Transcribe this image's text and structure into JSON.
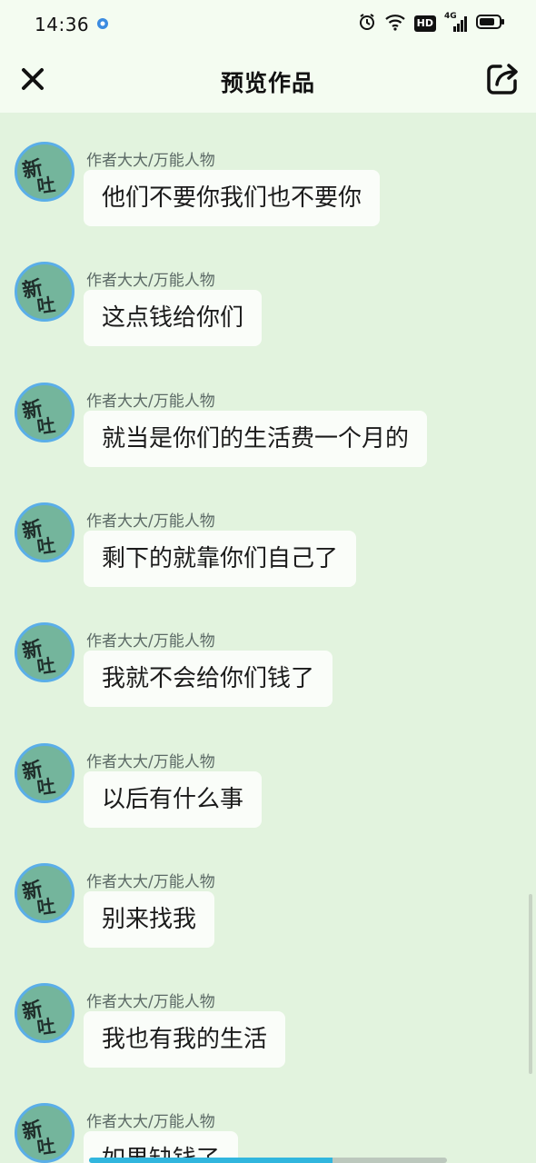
{
  "status_bar": {
    "time": "14:36",
    "network": "4G",
    "hd_badge": "HD",
    "icons": [
      "app-notification-icon",
      "alarm-icon",
      "wifi-icon",
      "hd-icon",
      "signal-icon",
      "battery-icon"
    ]
  },
  "header": {
    "title": "预览作品",
    "left_icon": "close-icon",
    "right_icon": "share-icon"
  },
  "colors": {
    "background": "#e2f3de",
    "header_background": "#f4fcf1",
    "bubble": "#fafdf9",
    "avatar_fill": "#74b59c",
    "avatar_border": "#5aaee8",
    "progress": "#31b6de"
  },
  "messages": [
    {
      "author": "作者大大/万能人物",
      "text": "他们不要你我们也不要你"
    },
    {
      "author": "作者大大/万能人物",
      "text": "这点钱给你们"
    },
    {
      "author": "作者大大/万能人物",
      "text": "就当是你们的生活费一个月的"
    },
    {
      "author": "作者大大/万能人物",
      "text": "剩下的就靠你们自己了"
    },
    {
      "author": "作者大大/万能人物",
      "text": "我就不会给你们钱了"
    },
    {
      "author": "作者大大/万能人物",
      "text": "以后有什么事"
    },
    {
      "author": "作者大大/万能人物",
      "text": "别来找我"
    },
    {
      "author": "作者大大/万能人物",
      "text": "我也有我的生活"
    },
    {
      "author": "作者大大/万能人物",
      "text": "如果缺钱了"
    }
  ],
  "playback_progress": 0.68
}
